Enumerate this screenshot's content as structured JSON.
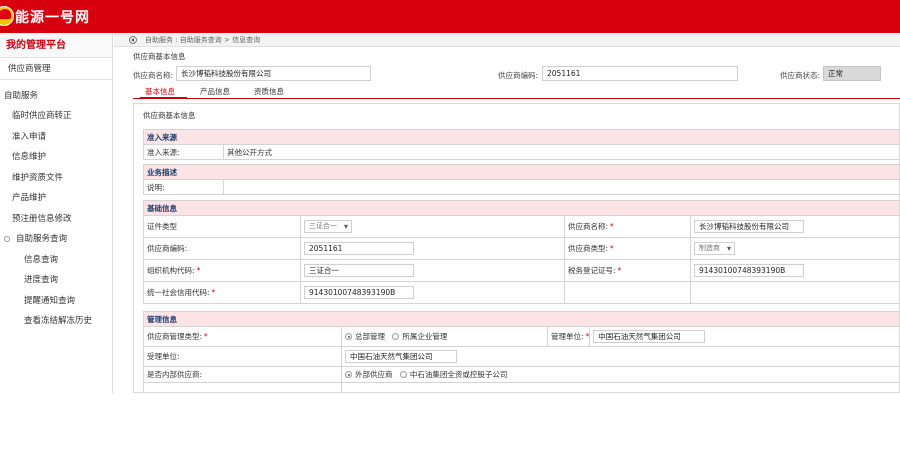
{
  "header": {
    "app_title": "能源一号网",
    "logo_text": "石油"
  },
  "sidebar": {
    "title": "我的管理平台",
    "manager": "供应商管理",
    "section": "自助服务",
    "items": [
      "临时供应商转正",
      "准入申请",
      "信息维护",
      "维护资质文件",
      "产品维护",
      "预注册信息修改"
    ],
    "group": "自助服务查询",
    "sub_items": [
      "信息查询",
      "进度查询",
      "提醒通知查询",
      "查看冻结解冻历史"
    ]
  },
  "breadcrumb": "自助服务 : 自助服务查询 > 信息查询",
  "section_title": "供应商基本信息",
  "info": {
    "name_label": "供应商名称:",
    "name_value": "长沙博韬科技股份有限公司",
    "code_label": "供应商编码:",
    "code_value": "2051161",
    "status_label": "供应商状态:",
    "status_value": "正常"
  },
  "tabs": [
    "基本信息",
    "产品信息",
    "资质信息"
  ],
  "panel_title": "供应商基本信息",
  "access": {
    "title": "准入来源",
    "label": "准入来源:",
    "value": "其他公开方式"
  },
  "business": {
    "title": "业务描述",
    "label": "说明:"
  },
  "basic": {
    "title": "基础信息",
    "cert_type_label": "证件类型",
    "cert_type_value": "三证合一",
    "supplier_name_label": "供应商名称:",
    "supplier_name_value": "长沙博韬科技股份有限公司",
    "supplier_code_label": "供应商编码:",
    "supplier_code_value": "2051161",
    "supplier_type_label": "供应商类型:",
    "supplier_type_value": "制造商",
    "org_code_label": "组织机构代码:",
    "org_code_value": "三证合一",
    "tax_label": "税务登记证号:",
    "tax_value": "91430100748393190B",
    "credit_label": "统一社会信用代码:",
    "credit_value": "91430100748393190B"
  },
  "management": {
    "title": "管理信息",
    "mgmt_type_label": "供应商管理类型:",
    "mgmt_opt1": "总部管理",
    "mgmt_opt2": "所属企业管理",
    "unit_label": "管理单位:",
    "unit_value": "中国石油天然气集团公司",
    "accept_label": "受理单位:",
    "accept_value": "中国石油天然气集团公司",
    "internal_label": "是否内部供应商:",
    "internal_opt1": "外部供应商",
    "internal_opt2": "中石油集团全资或控股子公司"
  }
}
